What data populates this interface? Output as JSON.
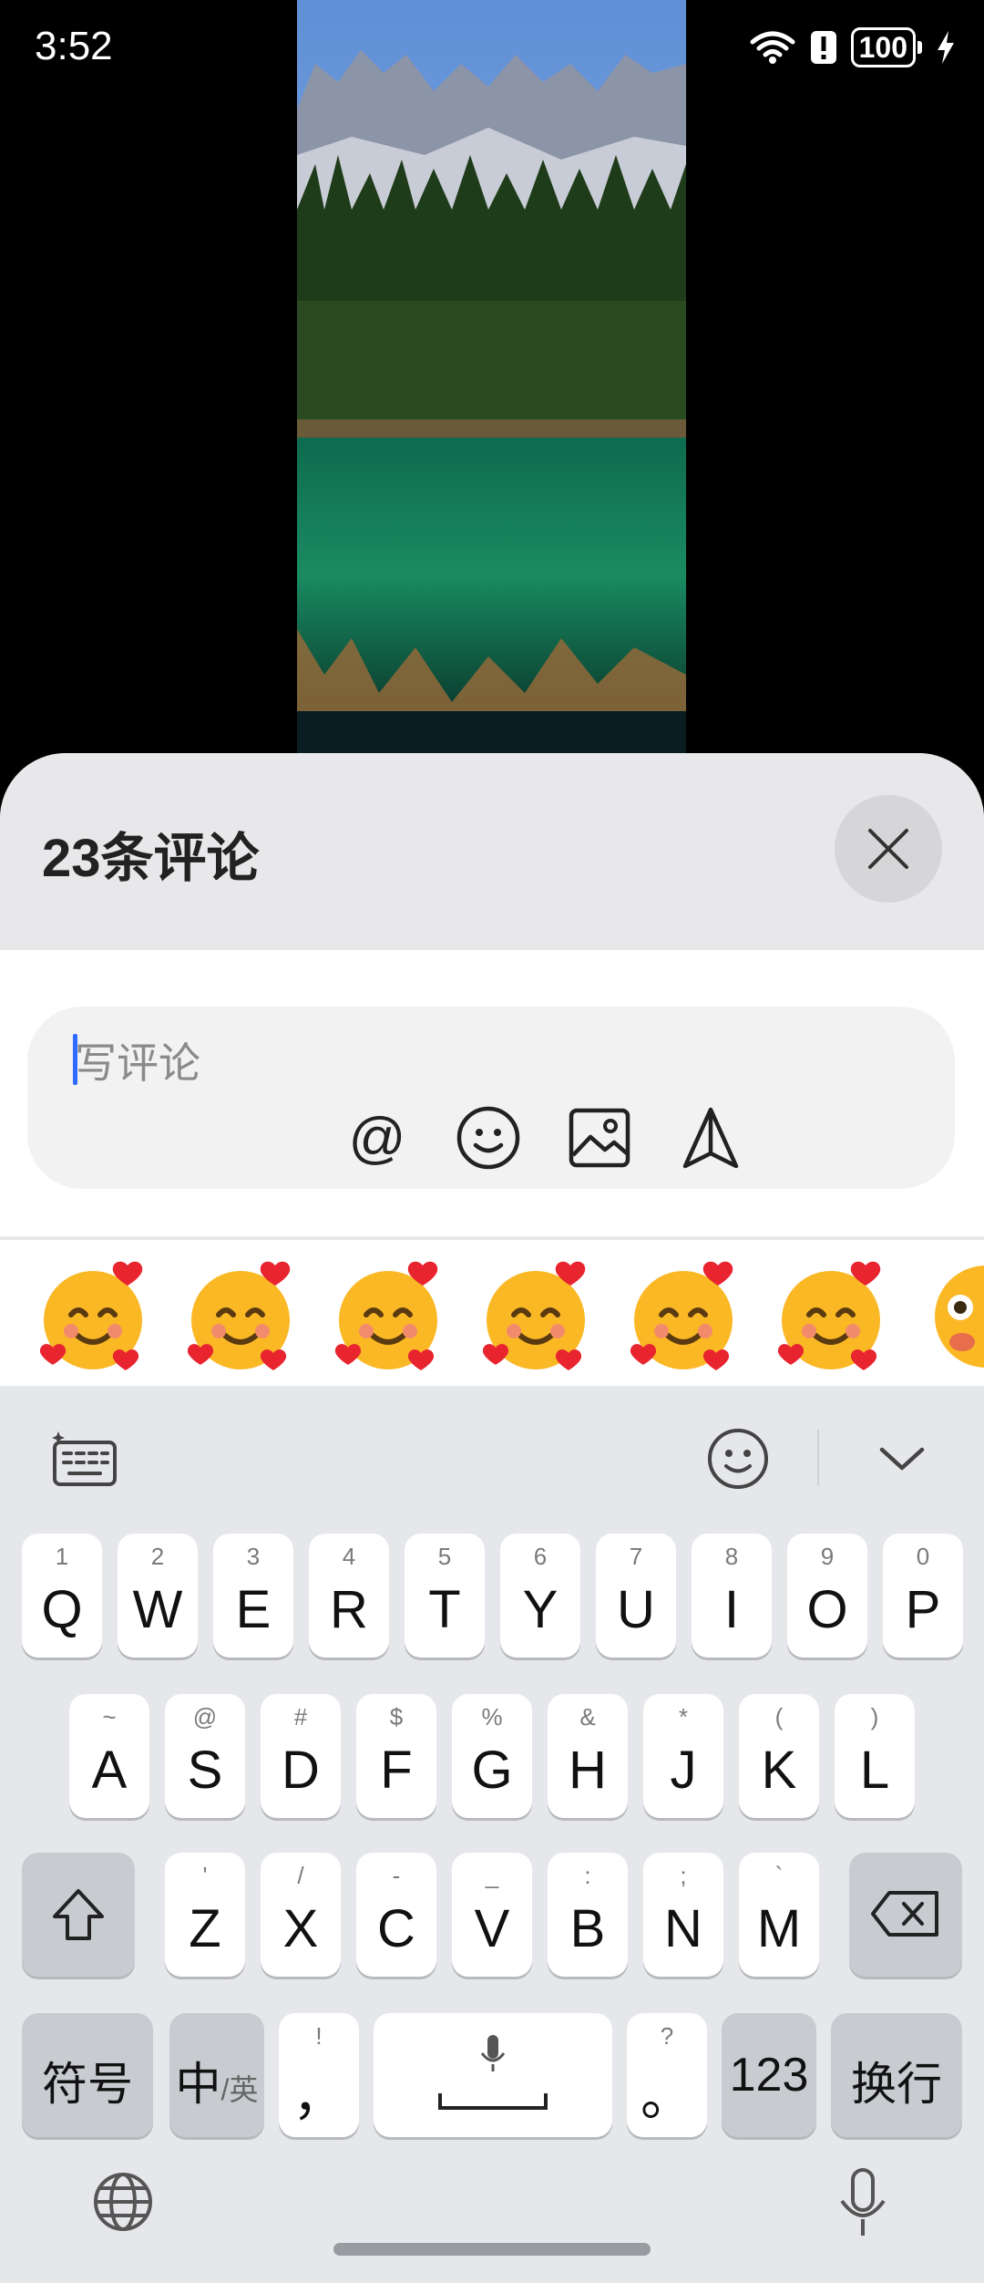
{
  "status_bar": {
    "time": "3:52",
    "battery": "100",
    "icons": [
      "wifi-icon",
      "alert-icon",
      "battery-icon",
      "charging-icon"
    ]
  },
  "comments": {
    "title": "23条评论",
    "input_placeholder": "写评论",
    "tool_icons": [
      "at-icon",
      "emoji-icon",
      "image-icon",
      "send-icon"
    ],
    "at_label": "@"
  },
  "emoji_bar": {
    "items": [
      "smiling-face-with-hearts",
      "smiling-face-with-hearts",
      "smiling-face-with-hearts",
      "smiling-face-with-hearts",
      "smiling-face-with-hearts",
      "smiling-face-with-hearts",
      "partial-emoji"
    ]
  },
  "keyboard": {
    "row1": [
      {
        "hint": "1",
        "label": "Q"
      },
      {
        "hint": "2",
        "label": "W"
      },
      {
        "hint": "3",
        "label": "E"
      },
      {
        "hint": "4",
        "label": "R"
      },
      {
        "hint": "5",
        "label": "T"
      },
      {
        "hint": "6",
        "label": "Y"
      },
      {
        "hint": "7",
        "label": "U"
      },
      {
        "hint": "8",
        "label": "I"
      },
      {
        "hint": "9",
        "label": "O"
      },
      {
        "hint": "0",
        "label": "P"
      }
    ],
    "row2": [
      {
        "hint": "~",
        "label": "A"
      },
      {
        "hint": "@",
        "label": "S"
      },
      {
        "hint": "#",
        "label": "D"
      },
      {
        "hint": "$",
        "label": "F"
      },
      {
        "hint": "%",
        "label": "G"
      },
      {
        "hint": "&",
        "label": "H"
      },
      {
        "hint": "*",
        "label": "J"
      },
      {
        "hint": "(",
        "label": "K"
      },
      {
        "hint": ")",
        "label": "L"
      }
    ],
    "row3": [
      {
        "hint": "'",
        "label": "Z"
      },
      {
        "hint": "/",
        "label": "X"
      },
      {
        "hint": "-",
        "label": "C"
      },
      {
        "hint": "_",
        "label": "V"
      },
      {
        "hint": ":",
        "label": "B"
      },
      {
        "hint": ";",
        "label": "N"
      },
      {
        "hint": "`",
        "label": "M"
      }
    ],
    "symbols": "符号",
    "lang_main": "中",
    "lang_sub": "/英",
    "comma_hint": "!",
    "comma": "，",
    "period_hint": "?",
    "period": "。",
    "numbers": "123",
    "enter": "换行"
  },
  "colors": {
    "accent": "#2f6bff",
    "sheet": "#e8e8ea",
    "keyboard": "#e6e7ea"
  }
}
